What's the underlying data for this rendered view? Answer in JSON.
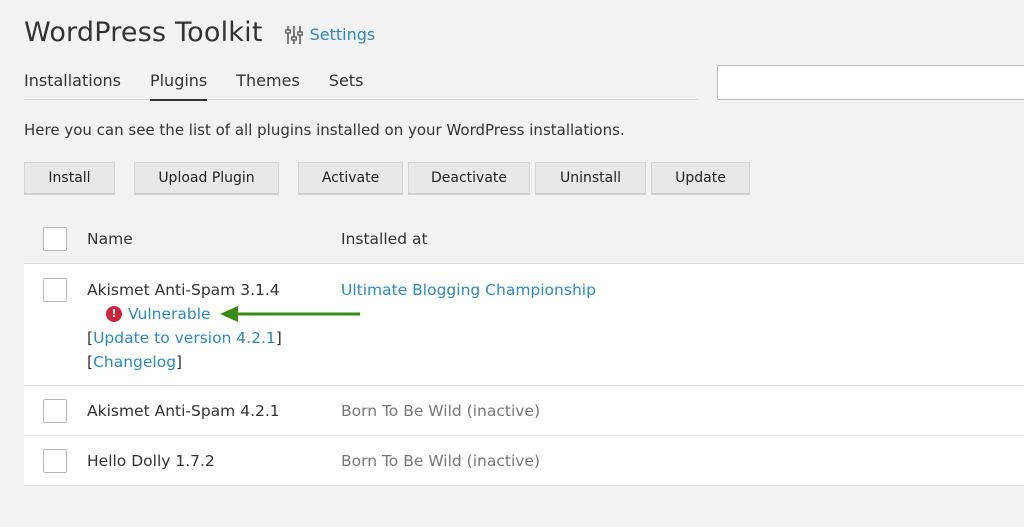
{
  "header": {
    "title": "WordPress Toolkit",
    "settings_label": "Settings"
  },
  "tabs": [
    {
      "label": "Installations",
      "active": false
    },
    {
      "label": "Plugins",
      "active": true
    },
    {
      "label": "Themes",
      "active": false
    },
    {
      "label": "Sets",
      "active": false
    }
  ],
  "search": {
    "value": "",
    "placeholder": ""
  },
  "description": "Here you can see the list of all plugins installed on your WordPress installations.",
  "toolbar": {
    "install": "Install",
    "upload": "Upload Plugin",
    "activate": "Activate",
    "deactivate": "Deactivate",
    "uninstall": "Uninstall",
    "update": "Update"
  },
  "table": {
    "headers": {
      "name": "Name",
      "installed_at": "Installed at"
    },
    "rows": [
      {
        "name": "Akismet Anti-Spam 3.1.4",
        "vulnerable_label": "Vulnerable",
        "update_label": "Update to version 4.2.1",
        "changelog_label": "Changelog",
        "open_bracket": "[",
        "close_bracket": "]",
        "installed_at": "Ultimate Blogging Championship"
      },
      {
        "name": "Akismet Anti-Spam 4.2.1",
        "installed_at": "Born To Be Wild (inactive)"
      },
      {
        "name": "Hello Dolly 1.7.2",
        "installed_at": "Born To Be Wild (inactive)"
      }
    ]
  },
  "colors": {
    "link": "#2a8bbd",
    "vulnerable_badge": "#d0243c",
    "annotation_arrow": "#3a8a16"
  },
  "icons": {
    "settings": "sliders-icon",
    "vulnerable": "exclamation-circle-icon",
    "annotation": "arrow-left-icon"
  }
}
